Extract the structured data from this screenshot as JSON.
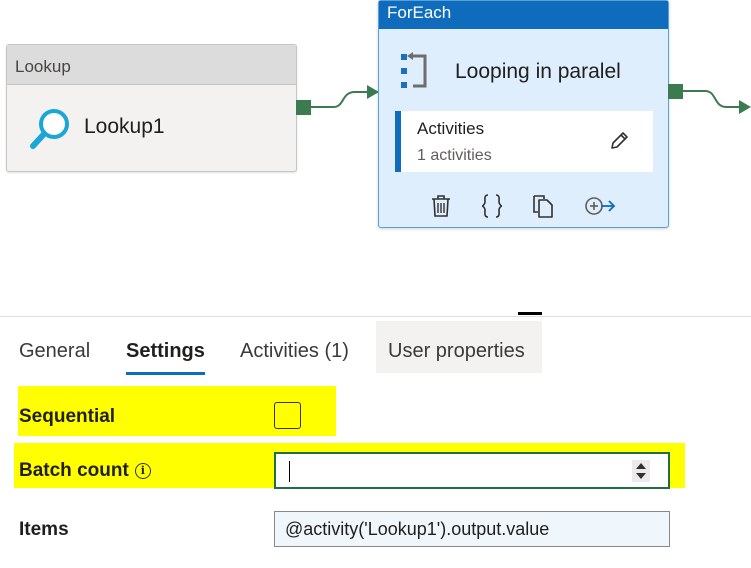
{
  "canvas": {
    "lookup_node": {
      "header": "Lookup",
      "name": "Lookup1",
      "icon": "search-icon"
    },
    "foreach_node": {
      "header": "ForEach",
      "name": "Looping in paralel",
      "icon": "loop-icon",
      "activities": {
        "title": "Activities",
        "count": "1 activities",
        "edit_icon": "pencil-icon"
      },
      "actions": [
        "delete-icon",
        "code-icon",
        "copy-icon",
        "add-output-icon"
      ]
    },
    "colors": {
      "success": "#3c7b4f",
      "foreach_header": "#0f6cbd",
      "foreach_body": "#deeefc"
    }
  },
  "panel": {
    "tabs": [
      {
        "label": "General",
        "active": false
      },
      {
        "label": "Settings",
        "active": true
      },
      {
        "label": "Activities (1)",
        "active": false
      },
      {
        "label": "User properties",
        "active": false
      }
    ],
    "settings": {
      "sequential": {
        "label": "Sequential",
        "checked": false
      },
      "batch_count": {
        "label": "Batch count",
        "info_icon": "info-icon",
        "value": ""
      },
      "items": {
        "label": "Items",
        "value": "@activity('Lookup1').output.value"
      }
    },
    "highlight_color": "#ffff00"
  }
}
